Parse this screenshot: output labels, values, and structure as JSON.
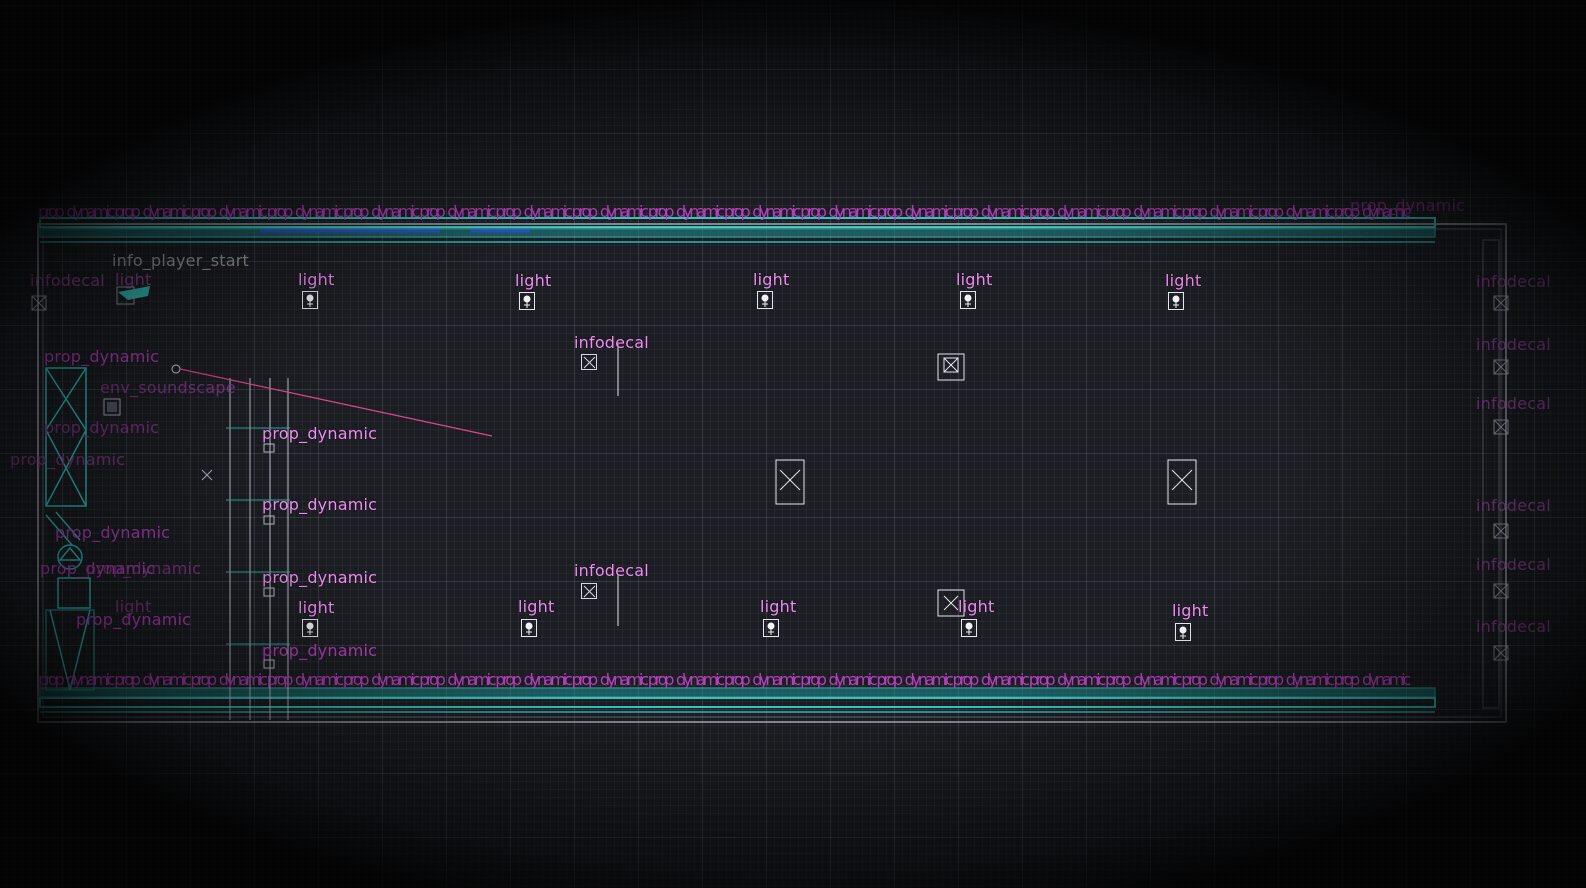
{
  "editor": {
    "view": "2D top view",
    "colors": {
      "background": "#1b1d22",
      "grid": "#aaafc3",
      "brush_wall": "#2fc6c0",
      "entity_label": "#f08cf2",
      "prop_label": "#b53fbd",
      "player_start_label": "#97a7a0",
      "selection_line": "#e0478f"
    }
  },
  "labels": {
    "prop_dynamic": "prop_dynamic",
    "infodecal": "infodecal",
    "light": "light",
    "info_player_start": "info_player_start",
    "env_soundscape": "env_soundscape",
    "prop_top_row": "prop_dynamic prop_dynamic prop_dynamic prop_dynamic prop_dynamic prop_dynamic prop_dynamic prop_dynamic prop_dynamic prop_dynamic prop_dynamic prop_dynamic prop_dynamic prop_dynamic prop_dynamic prop_dynamic prop_dynamic prop_dynamic",
    "prop_bottom_row": "prop_dynamic prop_dynamic prop_dynamic prop_dynamic prop_dynamic prop_dynamic prop_dynamic prop_dynamic prop_dynamic prop_dynamic prop_dynamic prop_dynamic prop_dynamic prop_dynamic prop_dynamic prop_dynamic prop_dynamic prop_dynamic"
  },
  "icons": {
    "light": "light-bulb-icon",
    "infodecal": "decal-box-icon",
    "player_start": "player-start-icon",
    "soundscape": "soundscape-icon"
  }
}
